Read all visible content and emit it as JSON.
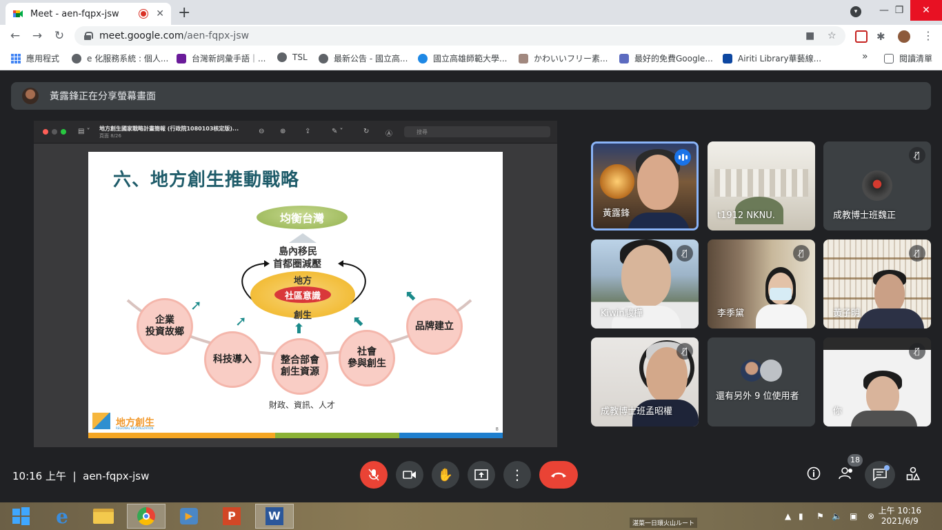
{
  "browser": {
    "tab_title": "Meet - aen-fqpx-jsw",
    "url_host": "meet.google.com",
    "url_path": "/aen-fqpx-jsw"
  },
  "bookmarks": [
    {
      "label": "應用程式",
      "icon": "apps-grid-icon"
    },
    {
      "label": "e 化服務系統 : 個人...",
      "icon": "globe-icon"
    },
    {
      "label": "台灣新詞彙手語｜...",
      "icon": "site-icon"
    },
    {
      "label": "TSL",
      "icon": "globe-icon"
    },
    {
      "label": "最新公告 - 國立高...",
      "icon": "globe-icon"
    },
    {
      "label": "國立高雄師範大學...",
      "icon": "nknu-icon"
    },
    {
      "label": "かわいいフリー素...",
      "icon": "irasutoya-icon"
    },
    {
      "label": "最好的免費Google...",
      "icon": "slides-icon"
    },
    {
      "label": "Airiti Library華藝線...",
      "icon": "airiti-icon"
    }
  ],
  "bookmarks_more": "»",
  "reading_list": "閱讀清單",
  "meet": {
    "presenting_banner": "黃露鋒正在分享螢幕畫面",
    "shared_window": {
      "doc_title": "地方創生國家戰略計畫簡報 (行政院1080103核定版)...",
      "page_indicator": "頁面 8/26",
      "search_placeholder": "搜尋"
    },
    "slide": {
      "title": "六、地方創生推動戰略",
      "balance": "均衡台灣",
      "migration": "島內移民",
      "pressure": "首都圈減壓",
      "local": "地方",
      "community": "社區意識",
      "creation": "創生",
      "c1": "企業\n投資故鄉",
      "c2": "科技導入",
      "c3": "整合部會\n創生資源",
      "c4": "社會\n參與創生",
      "c5": "品牌建立",
      "resources": "財政、資訊、人才",
      "logo": "地方創生",
      "logo_sub": "REGIONAL REVITALIZATION",
      "page_num": "8"
    },
    "participants": [
      {
        "name": "黃露鋒"
      },
      {
        "name": "t1912 NKNU."
      },
      {
        "name": "成教博士班魏正"
      },
      {
        "name": "Kiwin駿樺"
      },
      {
        "name": "李季黛"
      },
      {
        "name": "黃子明"
      },
      {
        "name": "成教博士班孟昭權"
      },
      {
        "name": "還有另外 9 位使用者"
      },
      {
        "name": "你"
      }
    ],
    "meeting_time": "10:16 上午",
    "meeting_code": "aen-fqpx-jsw",
    "participant_count": "18"
  },
  "taskbar": {
    "time": "上午 10:16",
    "date": "2021/6/9",
    "ime_text": "湛菜一日環火山ルート"
  }
}
